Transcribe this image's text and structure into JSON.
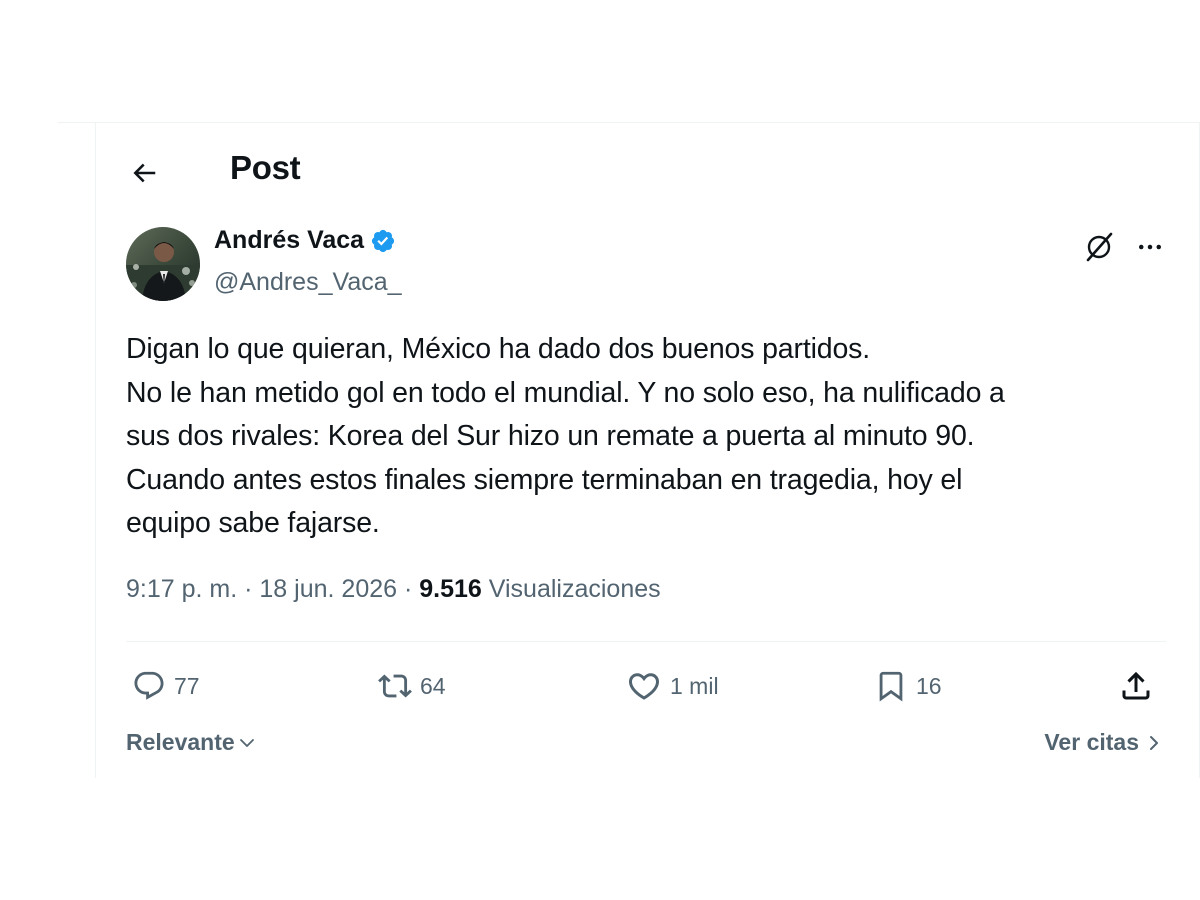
{
  "header": {
    "title": "Post"
  },
  "author": {
    "name": "Andrés Vaca",
    "handle": "@Andres_Vaca_",
    "verified_color": "#1d9bf0"
  },
  "post": {
    "lines": [
      "Digan lo que quieran, México ha dado dos buenos partidos.",
      "No le han metido gol en todo el mundial. Y no solo eso, ha nulificado a",
      "sus dos rivales: Korea del Sur hizo un remate a puerta al minuto 90.",
      "Cuando antes estos finales siempre terminaban en tragedia, hoy el",
      "equipo sabe fajarse."
    ],
    "time": "9:17 p. m.",
    "date": "18 jun. 2026",
    "separator": "·",
    "views_count": "9.516",
    "views_label": "Visualizaciones"
  },
  "actions": {
    "replies": "77",
    "reposts": "64",
    "likes": "1 mil",
    "bookmarks": "16"
  },
  "footer": {
    "sort_label": "Relevante",
    "quotes_label": "Ver citas"
  },
  "icons": {
    "back": "arrow-left-icon",
    "verified": "verified-badge-icon",
    "grok": "grok-icon",
    "more": "more-dots-icon",
    "reply": "reply-icon",
    "repost": "repost-icon",
    "like": "heart-icon",
    "bookmark": "bookmark-icon",
    "share": "share-icon"
  },
  "colors": {
    "text_primary": "#0f1419",
    "text_secondary": "#536471",
    "divider": "#eff3f4"
  }
}
